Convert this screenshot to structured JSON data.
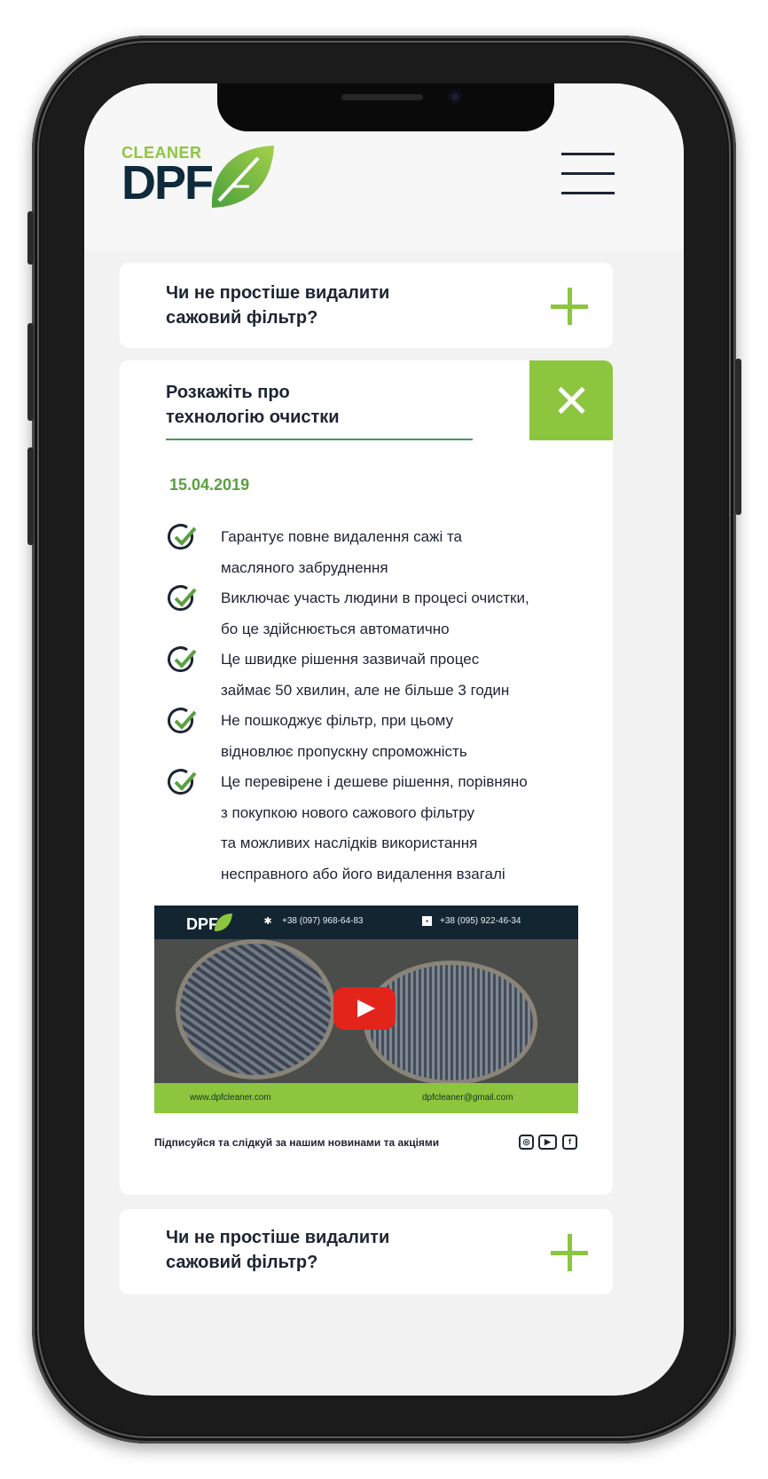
{
  "header": {
    "logo_small_text": "CLEANER",
    "logo_big_text": "DPF"
  },
  "faq": {
    "item_1": {
      "question_line1": "Чи не простіше видалити",
      "question_line2": "сажовий фільтр?"
    },
    "item_2": {
      "question_line1": "Розкажіть про",
      "question_line2": "технологію очистки",
      "date": "15.04.2019",
      "benefits": [
        {
          "line1": "Гарантує повне видалення сажі та",
          "line2": "масляного забруднення"
        },
        {
          "line1": "Виключає участь людини в процесі очистки,",
          "line2": "бо це здійснюється автоматично"
        },
        {
          "line1": "Це швидке рішення зазвичай процес",
          "line2": "займає 50 хвилин, але не більше 3 годин"
        },
        {
          "line1": "Не пошкоджує фільтр, при цьому",
          "line2": "відновлює пропускну спроможність"
        },
        {
          "line1": "Це перевірене і дешеве рішення, порівняно",
          "line2": "з покупкою нового сажового фільтру",
          "line3": "та можливих наслідків використання",
          "line4": "несправного або його видалення взагалі"
        }
      ],
      "video": {
        "logo_text": "DPF",
        "phone_1": "+38 (097) 968-64-83",
        "phone_2": "+38 (095) 922-46-34",
        "website": "www.dpfcleaner.com",
        "email": "dpfcleaner@gmail.com"
      },
      "subscribe_text": "Підписуйся та слідкуй за нашим новинами та акціями",
      "social": {
        "instagram": "◎",
        "youtube": "▶",
        "facebook": "f"
      }
    },
    "item_3": {
      "question_line1": "Чи не простіше видалити",
      "question_line2": "сажовий фільтр?"
    }
  },
  "colors": {
    "accent": "#8cc63f",
    "text": "#1d2433",
    "date": "#5aa03f",
    "navy": "#0f2a3b"
  }
}
